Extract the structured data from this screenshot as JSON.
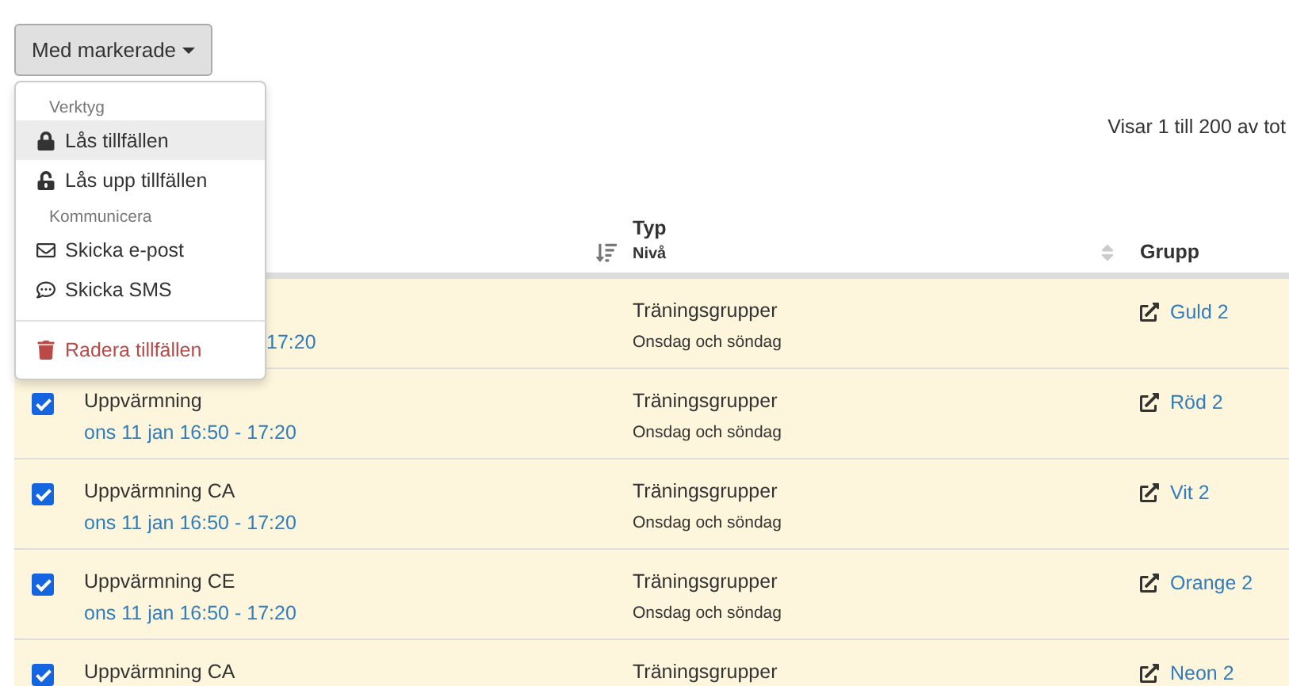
{
  "bulk_button": {
    "label": "Med markerade"
  },
  "bulk_menu": {
    "items": [
      {
        "kind": "header",
        "label": "Verktyg"
      },
      {
        "kind": "lock",
        "label": "Lås tillfällen",
        "selected": true
      },
      {
        "kind": "unlock",
        "label": "Lås upp tillfällen",
        "selected": false
      },
      {
        "kind": "header",
        "label": "Kommunicera"
      },
      {
        "kind": "mail",
        "label": "Skicka e-post",
        "selected": false
      },
      {
        "kind": "sms",
        "label": "Skicka SMS",
        "selected": false
      },
      {
        "kind": "divider"
      },
      {
        "kind": "delete",
        "label": "Radera tillfällen",
        "selected": false
      }
    ]
  },
  "info": "Visar 1 till 200 av tot",
  "table": {
    "columns": [
      {},
      {
        "title": "Typ",
        "subtitle": "Nivå"
      },
      {
        "title": "Grupp"
      }
    ],
    "rows": [
      {
        "time": "17:20",
        "type": "Träningsgrupper",
        "level": "Onsdag och söndag",
        "group": "Guld 2"
      },
      {
        "checked": true,
        "name": "Uppvärmning",
        "time": "ons 11 jan 16:50 - 17:20",
        "type": "Träningsgrupper",
        "level": "Onsdag och söndag",
        "group": "Röd 2"
      },
      {
        "checked": true,
        "name": "Uppvärmning CA",
        "time": "ons 11 jan 16:50 - 17:20",
        "type": "Träningsgrupper",
        "level": "Onsdag och söndag",
        "group": "Vit 2"
      },
      {
        "checked": true,
        "name": "Uppvärmning CE",
        "time": "ons 11 jan 16:50 - 17:20",
        "type": "Träningsgrupper",
        "level": "Onsdag och söndag",
        "group": "Orange 2"
      },
      {
        "checked": true,
        "name": "Uppvärmning CA",
        "type": "Träningsgrupper",
        "group": "Neon 2"
      }
    ]
  }
}
